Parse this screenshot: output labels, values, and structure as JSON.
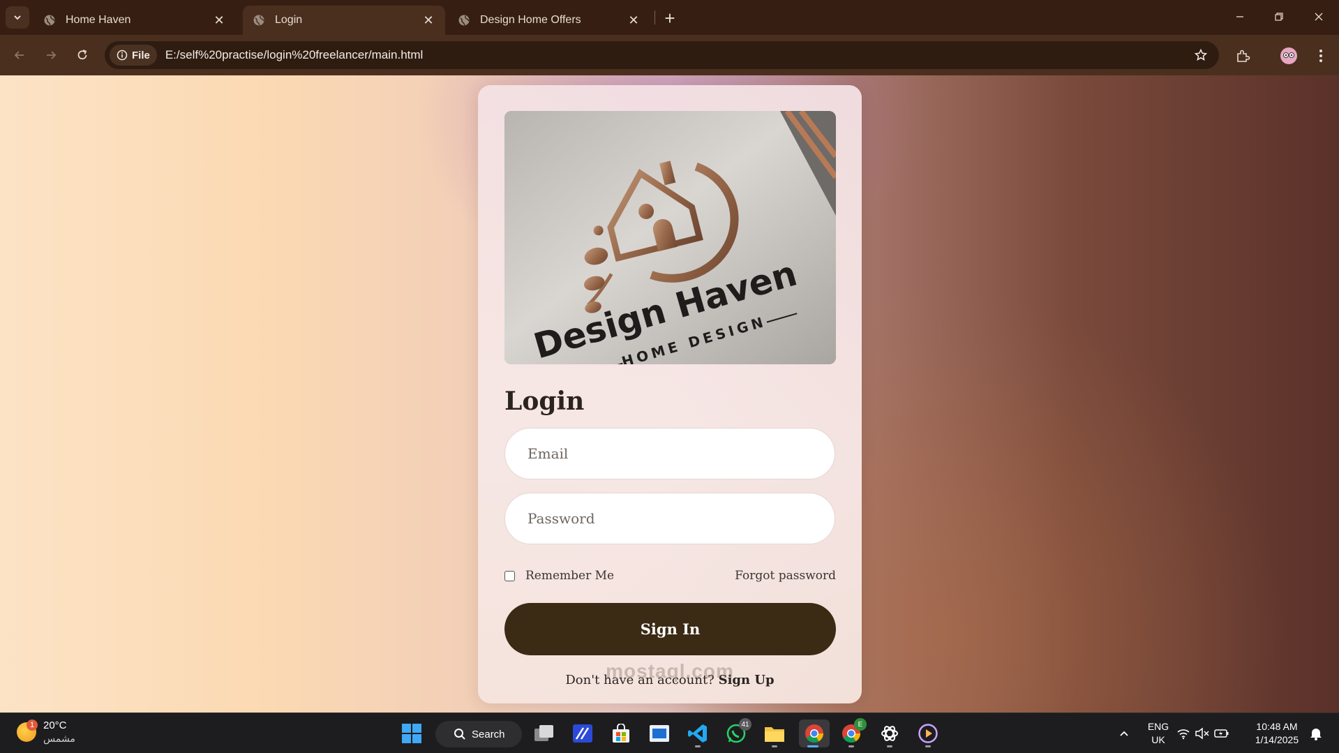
{
  "browser": {
    "tabs": [
      {
        "title": "Home Haven",
        "close": "✕"
      },
      {
        "title": "Login",
        "close": "✕"
      },
      {
        "title": "Design Home Offers",
        "close": "✕"
      }
    ],
    "new_tab": "+",
    "site_chip": "File",
    "url": "E:/self%20practise/login%20freelancer/main.html"
  },
  "page": {
    "logo": {
      "brand": "Design Haven",
      "tagline": "HOME DESIGN"
    },
    "title": "Login",
    "email_placeholder": "Email",
    "password_placeholder": "Password",
    "remember_label": "Remember Me",
    "remember_checked": false,
    "forgot_link": "Forgot password",
    "signin_button": "Sign In",
    "signup_prompt": "Don't have an account?",
    "signup_link": "Sign Up",
    "watermark": "mostaql.com"
  },
  "taskbar": {
    "weather": {
      "temp": "20°C",
      "condition": "مشمس",
      "badge": "1"
    },
    "search_label": "Search",
    "whatsapp_badge": "41",
    "chrome_profile_badge": "E",
    "language": {
      "line1": "ENG",
      "line2": "UK"
    },
    "clock": {
      "time": "10:48 AM",
      "date": "1/14/2025"
    }
  },
  "colors": {
    "tabstrip": "#361f12",
    "toolbar": "#4a2f1e",
    "signin_button": "#3b2a14",
    "taskbar": "#1d1d1f"
  }
}
